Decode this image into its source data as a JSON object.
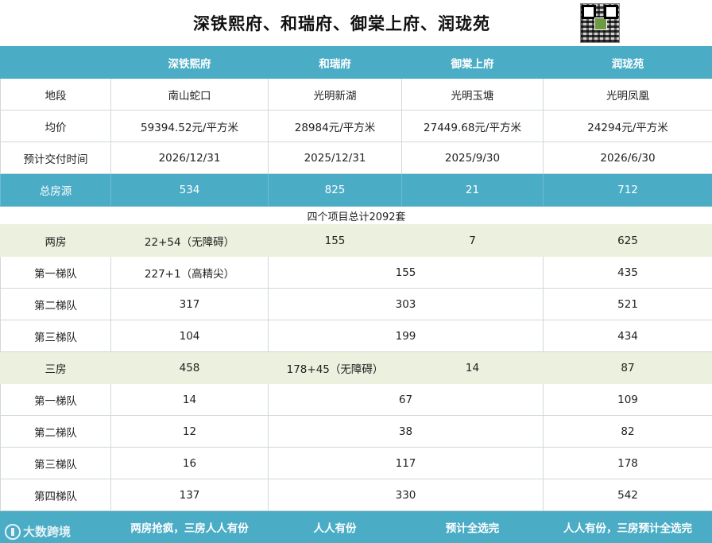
{
  "title": "深铁熙府、和瑞府、御棠上府、润珑苑",
  "headers": [
    "",
    "深铁熙府",
    "和瑞府",
    "御棠上府",
    "润珑苑"
  ],
  "info_rows": [
    {
      "label": "地段",
      "values": [
        "南山蛇口",
        "光明新湖",
        "光明玉塘",
        "光明凤凰"
      ]
    },
    {
      "label": "均价",
      "values": [
        "59394.52元/平方米",
        "28984元/平方米",
        "27449.68元/平方米",
        "24294元/平方米"
      ]
    },
    {
      "label": "预计交付时间",
      "values": [
        "2026/12/31",
        "2025/12/31",
        "2025/9/30",
        "2026/6/30"
      ]
    }
  ],
  "total": {
    "label": "总房源",
    "values": [
      "534",
      "825",
      "21",
      "712"
    ]
  },
  "total_note": "四个项目总计2092套",
  "two_room": {
    "label": "两房",
    "values": [
      "22+54（无障碍）",
      "155",
      "7",
      "625"
    ],
    "tiers": [
      {
        "label": "第一梯队",
        "a": "227+1（高精尖）",
        "mid": "155",
        "d": "435"
      },
      {
        "label": "第二梯队",
        "a": "317",
        "mid": "303",
        "d": "521"
      },
      {
        "label": "第三梯队",
        "a": "104",
        "mid": "199",
        "d": "434"
      }
    ]
  },
  "three_room": {
    "label": "三房",
    "values": [
      "458",
      "178+45（无障碍）",
      "14",
      "87"
    ],
    "tiers": [
      {
        "label": "第一梯队",
        "a": "14",
        "mid": "67",
        "d": "109"
      },
      {
        "label": "第二梯队",
        "a": "12",
        "mid": "38",
        "d": "82"
      },
      {
        "label": "第三梯队",
        "a": "16",
        "mid": "117",
        "d": "178"
      },
      {
        "label": "第四梯队",
        "a": "137",
        "mid": "330",
        "d": "542"
      }
    ]
  },
  "footer": [
    "两房抢疯，三房人人有份",
    "人人有份",
    "预计全选完",
    "人人有份，三房预计全选完"
  ],
  "watermark": "大数跨境",
  "colors": {
    "header": "#4bacc6",
    "green_row": "#ebf1de"
  }
}
